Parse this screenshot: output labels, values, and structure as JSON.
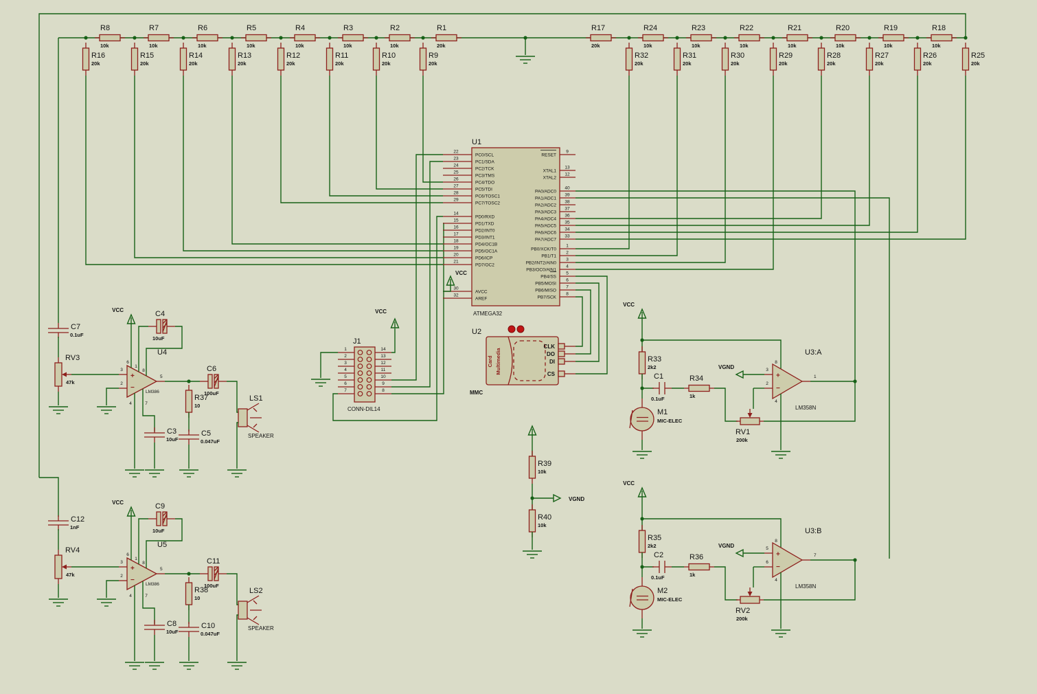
{
  "power": {
    "vcc": "VCC",
    "vgnd": "VGND"
  },
  "ladder": {
    "series_left": [
      {
        "ref": "R8",
        "value": "10k"
      },
      {
        "ref": "R7",
        "value": "10k"
      },
      {
        "ref": "R6",
        "value": "10k"
      },
      {
        "ref": "R5",
        "value": "10k"
      },
      {
        "ref": "R4",
        "value": "10k"
      },
      {
        "ref": "R3",
        "value": "10k"
      },
      {
        "ref": "R2",
        "value": "10k"
      },
      {
        "ref": "R1",
        "value": "20k"
      }
    ],
    "shunts_left": [
      {
        "ref": "R16",
        "value": "20k"
      },
      {
        "ref": "R15",
        "value": "20k"
      },
      {
        "ref": "R14",
        "value": "20k"
      },
      {
        "ref": "R13",
        "value": "20k"
      },
      {
        "ref": "R12",
        "value": "20k"
      },
      {
        "ref": "R11",
        "value": "20k"
      },
      {
        "ref": "R10",
        "value": "20k"
      },
      {
        "ref": "R9",
        "value": "20k"
      }
    ],
    "series_right": [
      {
        "ref": "R17",
        "value": "20k"
      },
      {
        "ref": "R24",
        "value": "10k"
      },
      {
        "ref": "R23",
        "value": "10k"
      },
      {
        "ref": "R22",
        "value": "10k"
      },
      {
        "ref": "R21",
        "value": "10k"
      },
      {
        "ref": "R20",
        "value": "10k"
      },
      {
        "ref": "R19",
        "value": "10k"
      },
      {
        "ref": "R18",
        "value": "10k"
      }
    ],
    "shunts_right": [
      {
        "ref": "R32",
        "value": "20k"
      },
      {
        "ref": "R31",
        "value": "20k"
      },
      {
        "ref": "R30",
        "value": "20k"
      },
      {
        "ref": "R29",
        "value": "20k"
      },
      {
        "ref": "R28",
        "value": "20k"
      },
      {
        "ref": "R27",
        "value": "20k"
      },
      {
        "ref": "R26",
        "value": "20k"
      },
      {
        "ref": "R25",
        "value": "20k"
      }
    ]
  },
  "mcu": {
    "ref": "U1",
    "part": "ATMEGA32",
    "left_pins": [
      {
        "num": "22",
        "name": "PC0/SCL"
      },
      {
        "num": "23",
        "name": "PC1/SDA"
      },
      {
        "num": "24",
        "name": "PC2/TCK"
      },
      {
        "num": "25",
        "name": "PC3/TMS"
      },
      {
        "num": "26",
        "name": "PC4/TDO"
      },
      {
        "num": "27",
        "name": "PC5/TDI"
      },
      {
        "num": "28",
        "name": "PC6/TOSC1"
      },
      {
        "num": "29",
        "name": "PC7/TOSC2"
      },
      {
        "num": "14",
        "name": "PD0/RXD"
      },
      {
        "num": "15",
        "name": "PD1/TXD"
      },
      {
        "num": "16",
        "name": "PD2/INT0"
      },
      {
        "num": "17",
        "name": "PD3/INT1"
      },
      {
        "num": "18",
        "name": "PD4/OC1B"
      },
      {
        "num": "19",
        "name": "PD5/OC1A"
      },
      {
        "num": "20",
        "name": "PD6/ICP"
      },
      {
        "num": "21",
        "name": "PD7/OC2"
      },
      {
        "num": "30",
        "name": "AVCC"
      },
      {
        "num": "32",
        "name": "AREF"
      }
    ],
    "right_pins": [
      {
        "num": "9",
        "name": "RESET"
      },
      {
        "num": "13",
        "name": "XTAL1"
      },
      {
        "num": "12",
        "name": "XTAL2"
      },
      {
        "num": "40",
        "name": "PA0/ADC0"
      },
      {
        "num": "39",
        "name": "PA1/ADC1"
      },
      {
        "num": "38",
        "name": "PA2/ADC2"
      },
      {
        "num": "37",
        "name": "PA3/ADC3"
      },
      {
        "num": "36",
        "name": "PA4/ADC4"
      },
      {
        "num": "35",
        "name": "PA5/ADC5"
      },
      {
        "num": "34",
        "name": "PA6/ADC6"
      },
      {
        "num": "33",
        "name": "PA7/ADC7"
      },
      {
        "num": "1",
        "name": "PB0/XCK/T0"
      },
      {
        "num": "2",
        "name": "PB1/T1"
      },
      {
        "num": "3",
        "name": "PB2/INT2/AIN0"
      },
      {
        "num": "4",
        "name": "PB3/OC0/AIN1"
      },
      {
        "num": "5",
        "name": "PB4/SS"
      },
      {
        "num": "6",
        "name": "PB5/MOSI"
      },
      {
        "num": "7",
        "name": "PB6/MISO"
      },
      {
        "num": "8",
        "name": "PB7/SCK"
      }
    ]
  },
  "header": {
    "ref": "J1",
    "part": "CONN-DIL14",
    "left": [
      "1",
      "2",
      "3",
      "4",
      "5",
      "6",
      "7"
    ],
    "right": [
      "14",
      "13",
      "12",
      "11",
      "10",
      "9",
      "8"
    ]
  },
  "mmc": {
    "ref": "U2",
    "part": "MMC",
    "card_line1": "Card",
    "card_line2": "Multimedia",
    "pins": [
      "CLK",
      "DO",
      "DI",
      "CS"
    ]
  },
  "mic_amp_a": {
    "ref": "U3:A",
    "part": "LM358N",
    "pin_plus": "3",
    "pin_minus": "2",
    "pin_out": "1",
    "pin_top": "8",
    "pin_bot": "4",
    "r_bias": {
      "ref": "R33",
      "value": "2k2"
    },
    "c_in": {
      "ref": "C1",
      "value": "0.1uF"
    },
    "r_in": {
      "ref": "R34",
      "value": "1k"
    },
    "pot": {
      "ref": "RV1",
      "value": "200k"
    },
    "mic": {
      "ref": "M1",
      "part": "MIC-ELEC"
    }
  },
  "mic_amp_b": {
    "ref": "U3:B",
    "part": "LM358N",
    "pin_plus": "5",
    "pin_minus": "6",
    "pin_out": "7",
    "pin_top": "8",
    "pin_bot": "4",
    "r_bias": {
      "ref": "R35",
      "value": "2k2"
    },
    "c_in": {
      "ref": "C2",
      "value": "0.1uF"
    },
    "r_in": {
      "ref": "R36",
      "value": "1k"
    },
    "pot": {
      "ref": "RV2",
      "value": "200k"
    },
    "mic": {
      "ref": "M2",
      "part": "MIC-ELEC"
    }
  },
  "amp_a": {
    "ref": "U4",
    "part": "LM386",
    "c_in": {
      "ref": "C7",
      "value": "0.1uF"
    },
    "pot": {
      "ref": "RV3",
      "value": "47k"
    },
    "c_byp": {
      "ref": "C4",
      "value": "10uF"
    },
    "c_dec": {
      "ref": "C3",
      "value": "10uF"
    },
    "c_out": {
      "ref": "C6",
      "value": "100uF"
    },
    "r_out": {
      "ref": "R37",
      "value": "10"
    },
    "c_fil": {
      "ref": "C5",
      "value": "0.047uF"
    },
    "spk": {
      "ref": "LS1",
      "part": "SPEAKER"
    },
    "pins": {
      "plus": "3",
      "minus": "2",
      "out": "5",
      "t1": "6",
      "t2": "1",
      "t3": "8",
      "b1": "4",
      "b2": "7"
    }
  },
  "amp_b": {
    "ref": "U5",
    "part": "LM386",
    "c_in": {
      "ref": "C12",
      "value": "1nF"
    },
    "pot": {
      "ref": "RV4",
      "value": "47k"
    },
    "c_byp": {
      "ref": "C9",
      "value": "10uF"
    },
    "c_dec": {
      "ref": "C8",
      "value": "10uF"
    },
    "c_out": {
      "ref": "C11",
      "value": "100uF"
    },
    "r_out": {
      "ref": "R38",
      "value": "10"
    },
    "c_fil": {
      "ref": "C10",
      "value": "0.047uF"
    },
    "spk": {
      "ref": "LS2",
      "part": "SPEAKER"
    },
    "pins": {
      "plus": "3",
      "minus": "2",
      "out": "5",
      "t1": "6",
      "t2": "1",
      "t3": "8",
      "b1": "4",
      "b2": "7"
    }
  },
  "divider": {
    "r_top": {
      "ref": "R39",
      "value": "10k"
    },
    "r_bot": {
      "ref": "R40",
      "value": "10k"
    }
  }
}
